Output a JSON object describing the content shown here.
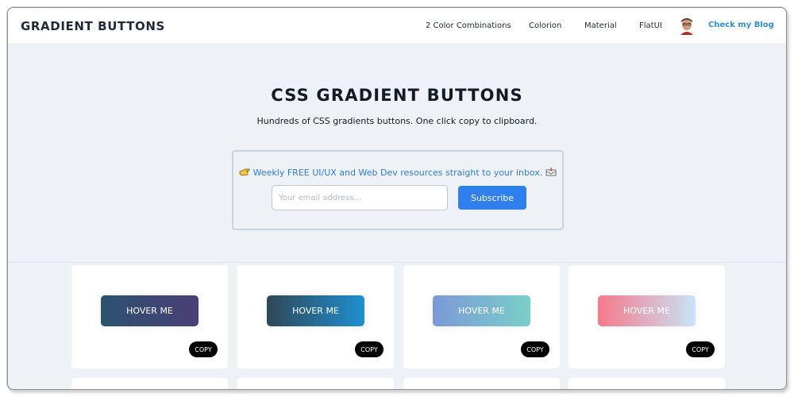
{
  "header": {
    "brand": "GRADIENT BUTTONS",
    "nav": [
      "2 Color Combinations",
      "Colorion",
      "Material",
      "FlatUI"
    ],
    "blog_link": "Check my Blog"
  },
  "hero": {
    "title": "CSS GRADIENT BUTTONS",
    "subtitle": "Hundreds of CSS gradients buttons. One click copy to clipboard."
  },
  "newsletter": {
    "text": "Weekly FREE UI/UX and Web Dev resources straight to your inbox.",
    "email_placeholder": "Your email address...",
    "email_value": "",
    "subscribe_label": "Subscribe"
  },
  "cards": [
    {
      "label": "HOVER ME",
      "copy_label": "COPY",
      "gradient": [
        "#2c5270",
        "#4a3f75"
      ]
    },
    {
      "label": "HOVER ME",
      "copy_label": "COPY",
      "gradient": [
        "#2f4858",
        "#1f8fd0"
      ]
    },
    {
      "label": "HOVER ME",
      "copy_label": "COPY",
      "gradient": [
        "#7c99d8",
        "#79cfc8"
      ]
    },
    {
      "label": "HOVER ME",
      "copy_label": "COPY",
      "gradient": [
        "#f47a8a",
        "#c8e4f8"
      ]
    }
  ],
  "colors": {
    "accent": "#2f80ed",
    "link": "#2f8fd6",
    "background": "#eef2f6"
  },
  "icons": [
    "pointing-hand-icon",
    "inbox-tray-icon",
    "avatar"
  ]
}
